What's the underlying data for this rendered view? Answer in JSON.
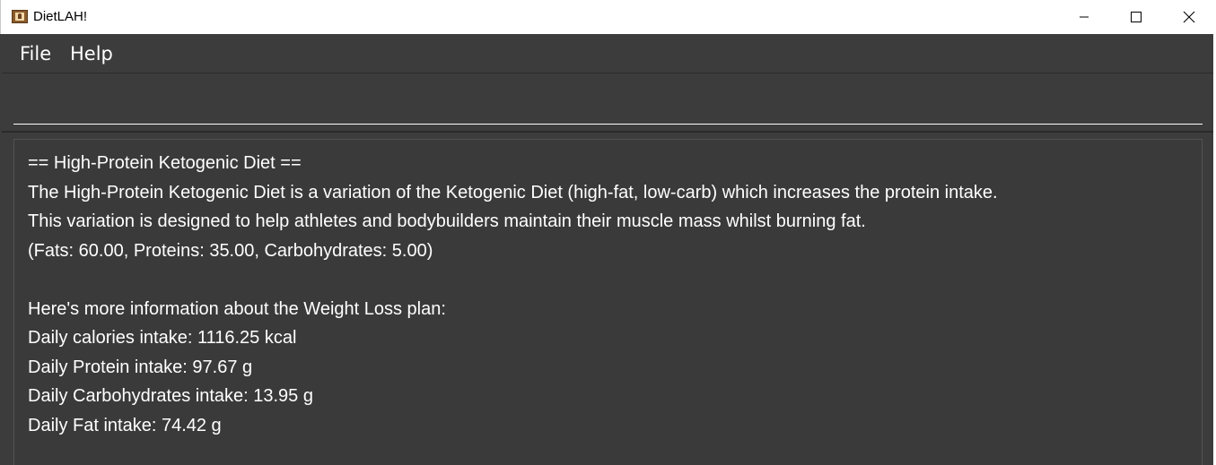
{
  "window": {
    "title": "DietLAH!"
  },
  "menu": {
    "file_label": "File",
    "help_label": "Help"
  },
  "command_box": {
    "value": "",
    "placeholder": ""
  },
  "result": {
    "lines": [
      "== High-Protein Ketogenic Diet ==",
      "The High-Protein Ketogenic Diet is a variation of the Ketogenic Diet (high-fat, low-carb) which increases the protein intake.",
      "This variation is designed to help athletes and bodybuilders maintain their muscle mass whilst burning fat.",
      "(Fats: 60.00, Proteins: 35.00, Carbohydrates: 5.00)",
      "",
      "Here's more information about the Weight Loss plan:",
      "Daily calories intake: 1116.25 kcal",
      "Daily Protein intake: 97.67 g",
      "Daily Carbohydrates intake: 13.95 g",
      "Daily Fat intake: 74.42 g"
    ]
  },
  "colors": {
    "background": "#3c3c3c",
    "text": "#ffffff",
    "titlebar": "#ffffff"
  },
  "icons": {
    "app": "app-icon",
    "minimize": "minimize-icon",
    "maximize": "maximize-icon",
    "close": "close-icon"
  }
}
